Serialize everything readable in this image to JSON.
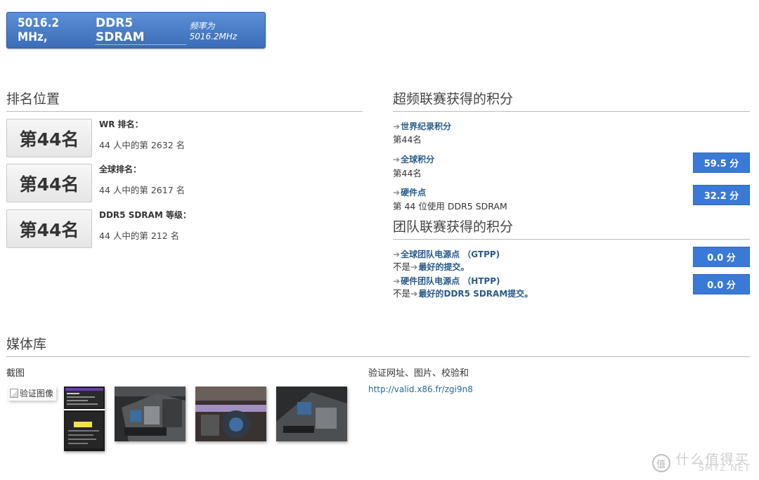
{
  "header": {
    "frequency": "5016.2 MHz,",
    "memory_type": "DDR5 SDRAM",
    "frequency_note": "频率为 5016.2MHz"
  },
  "ranking": {
    "title": "排名位置",
    "rows": [
      {
        "badge": "第44名",
        "label": "WR 排名：",
        "value": "44 人中的第 2632 名"
      },
      {
        "badge": "第44名",
        "label": "全球排名：",
        "value": "44 人中的第 2617 名"
      },
      {
        "badge": "第44名",
        "label": "DDR5 SDRAM 等级：",
        "value": "44 人中的第 212 名"
      }
    ]
  },
  "league_points": {
    "title": "超频联赛获得的积分",
    "items": [
      {
        "label": "世界纪录积分",
        "sub": "第44名",
        "points": null
      },
      {
        "label": "全球积分",
        "sub": "第44名",
        "points": "59.5 分"
      },
      {
        "label": "硬件点",
        "sub": "第 44 位使用 DDR5 SDRAM",
        "points": "32.2 分"
      }
    ]
  },
  "team_points": {
    "title": "团队联赛获得的积分",
    "items": [
      {
        "label": "全球团队电源点 （GTPP)",
        "sub_prefix": "不是",
        "sub_link": "最好的提交。",
        "points": "0.0 分"
      },
      {
        "label": "硬件团队电源点 （HTPP)",
        "sub_prefix": "不是",
        "sub_link": "最好的DDR5 SDRAM提交。",
        "points": "0.0 分"
      }
    ]
  },
  "media": {
    "title": "媒体库",
    "screenshot_label": "截图",
    "broken_image_alt": "验证图像",
    "validation_label": "验证网址、图片、校验和",
    "validation_url": "http://valid.x86.fr/zgi9n8"
  },
  "watermark": {
    "cn": "什么值得买",
    "en": "SMYZ.NET",
    "icon": "值"
  }
}
